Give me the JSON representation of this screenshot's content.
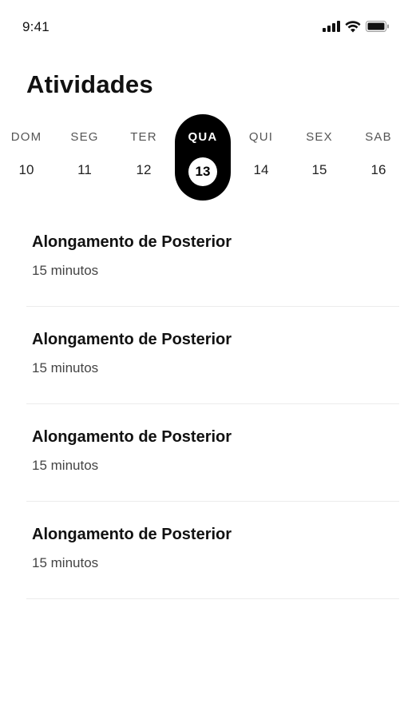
{
  "status_bar": {
    "time": "9:41"
  },
  "header": {
    "title": "Atividades"
  },
  "week": {
    "selected_index": 3,
    "days": [
      {
        "name": "DOM",
        "number": "10"
      },
      {
        "name": "SEG",
        "number": "11"
      },
      {
        "name": "TER",
        "number": "12"
      },
      {
        "name": "QUA",
        "number": "13"
      },
      {
        "name": "QUI",
        "number": "14"
      },
      {
        "name": "SEX",
        "number": "15"
      },
      {
        "name": "SAB",
        "number": "16"
      }
    ]
  },
  "activities": [
    {
      "title": "Alongamento de Posterior",
      "duration": "15 minutos"
    },
    {
      "title": "Alongamento de Posterior",
      "duration": "15 minutos"
    },
    {
      "title": "Alongamento de Posterior",
      "duration": "15 minutos"
    },
    {
      "title": "Alongamento de Posterior",
      "duration": "15 minutos"
    }
  ],
  "colors": {
    "accent": "#000000",
    "background": "#ffffff",
    "divider": "#ececec"
  }
}
